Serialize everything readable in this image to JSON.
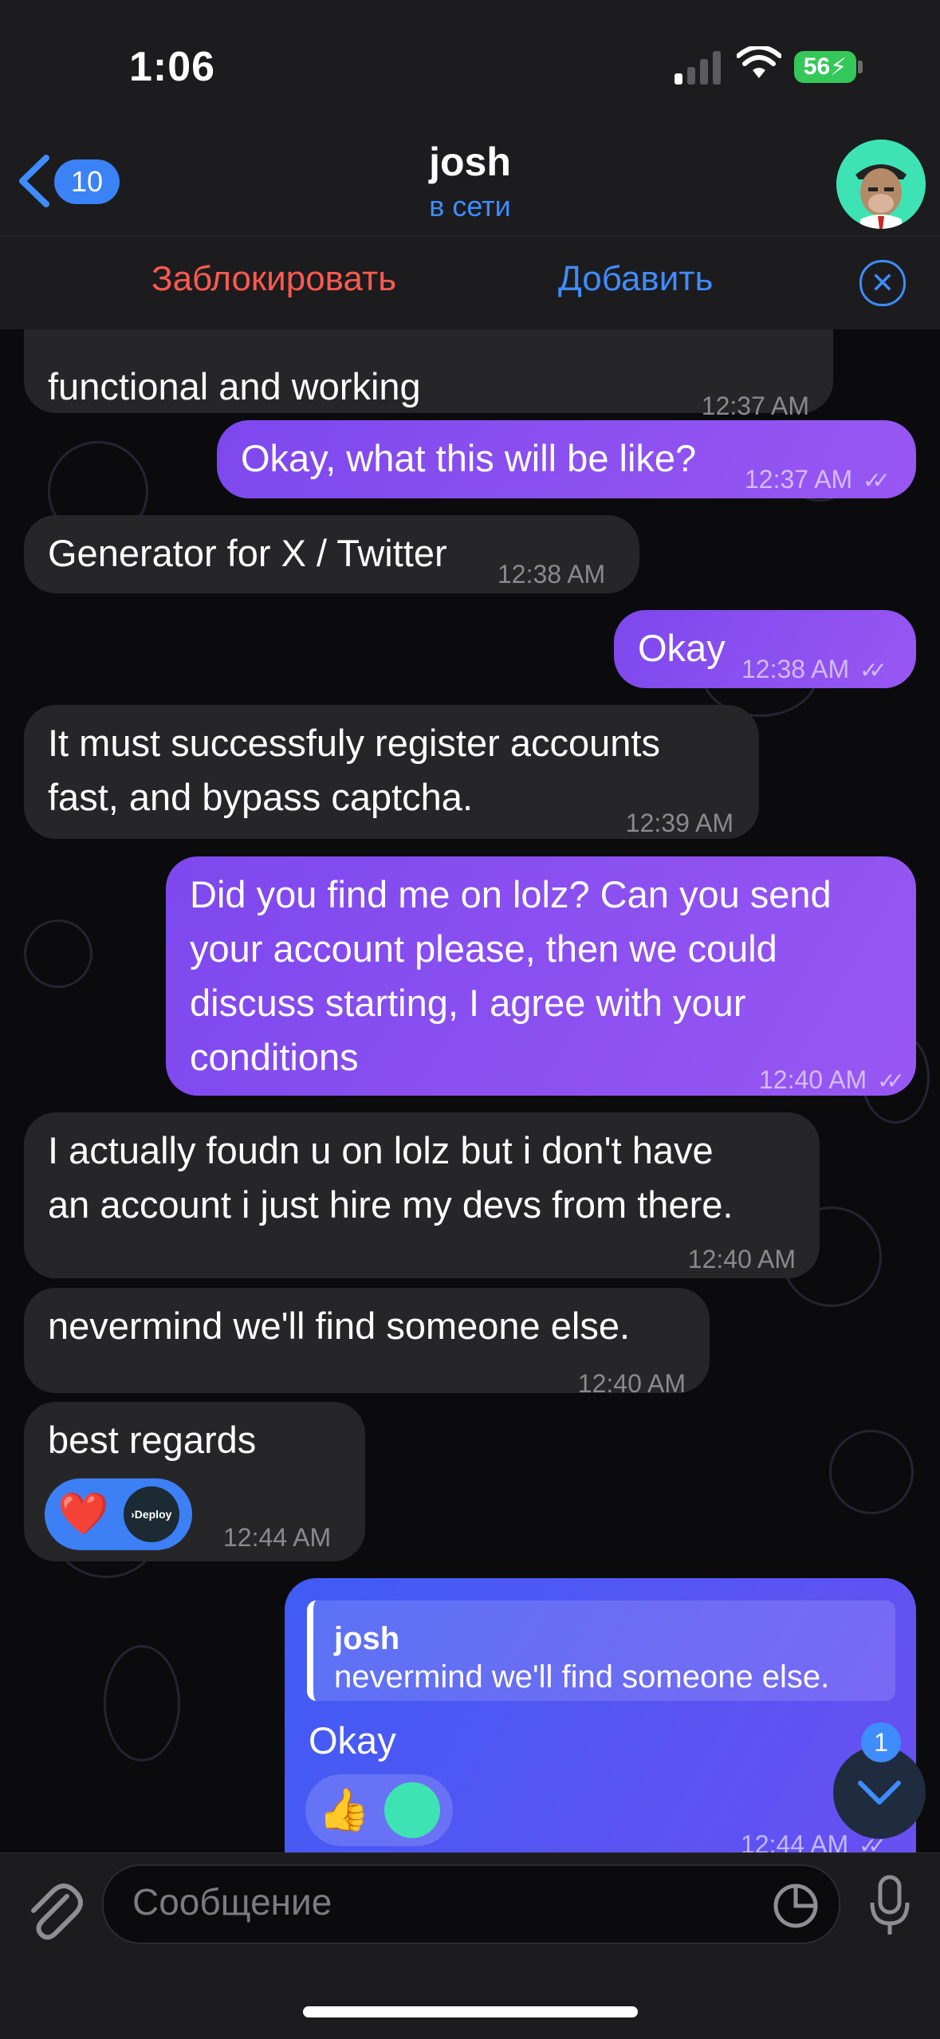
{
  "status_bar": {
    "time": "1:06",
    "battery": "56"
  },
  "header": {
    "back_count": "10",
    "title": "josh",
    "status": "в сети"
  },
  "action_bar": {
    "block_label": "Заблокировать",
    "add_label": "Добавить"
  },
  "messages": [
    {
      "dir": "in",
      "text": "functional and working",
      "time": "12:37 AM"
    },
    {
      "dir": "out",
      "text": "Okay, what this will be like?",
      "time": "12:37 AM"
    },
    {
      "dir": "in",
      "text": "Generator for X / Twitter",
      "time": "12:38 AM"
    },
    {
      "dir": "out",
      "text": "Okay",
      "time": "12:38 AM"
    },
    {
      "dir": "in",
      "lines": [
        "It must successfuly register accounts",
        "fast, and bypass captcha."
      ],
      "time": "12:39 AM"
    },
    {
      "dir": "out",
      "lines": [
        "Did you find me on lolz? Can you send",
        "your account please, then we could",
        "discuss starting, I agree with your",
        "conditions"
      ],
      "time": "12:40 AM"
    },
    {
      "dir": "in",
      "lines": [
        "I actually foudn u on lolz but i don't have",
        "an account i just hire my devs from there."
      ],
      "time": "12:40 AM"
    },
    {
      "dir": "in",
      "text": "nevermind we'll find someone else.",
      "time": "12:40 AM"
    },
    {
      "dir": "in",
      "text": "best regards",
      "time": "12:44 AM",
      "reactions": [
        "❤️",
        "Deploy"
      ]
    },
    {
      "dir": "out",
      "reply_to": {
        "name": "josh",
        "text": "nevermind we'll find someone else."
      },
      "text": "Okay",
      "time": "12:44 AM",
      "reactions": [
        "👍"
      ]
    }
  ],
  "scroll_down": {
    "unread": "1"
  },
  "composer": {
    "placeholder": "Сообщение"
  },
  "colors": {
    "accent": "#3f8cff",
    "outgoing": "#8b50f0",
    "incoming": "#262628",
    "danger": "#ff5a4f"
  }
}
